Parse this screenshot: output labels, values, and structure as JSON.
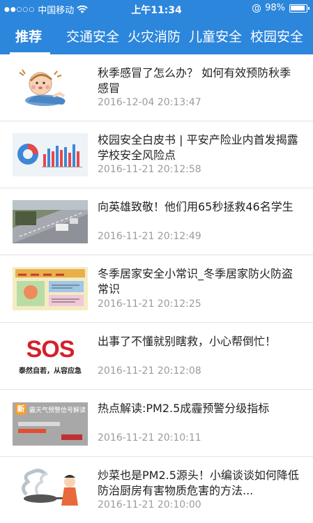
{
  "status_bar": {
    "carrier": "中国移动",
    "signal": "●●○○○",
    "time": "上午11:34",
    "battery": "98%"
  },
  "tabs": [
    {
      "label": "推荐",
      "active": true
    },
    {
      "label": "交通安全"
    },
    {
      "label": "火灾消防"
    },
    {
      "label": "儿童安全"
    },
    {
      "label": "校园安全"
    }
  ],
  "news": [
    {
      "title": "秋季感冒了怎么办？  如何有效预防秋季感冒",
      "date": "2016-12-04 20:13:47",
      "thumb": "cold-child-illustration"
    },
    {
      "title": "校园安全白皮书 | 平安产险业内首发揭露学校安全风险点",
      "date": "2016-11-21 20:12:58",
      "thumb": "bar-chart-infographic"
    },
    {
      "title": "向英雄致敬！他们用65秒拯救46名学生",
      "date": "2016-11-21 20:12:49",
      "thumb": "highway-photo"
    },
    {
      "title": "冬季居家安全小常识_冬季居家防火防盗常识",
      "date": "2016-11-21 20:12:25",
      "thumb": "children-drawing"
    },
    {
      "title": "出事了不懂就别瞎救，小心帮倒忙！",
      "date": "2016-11-21 20:12:08",
      "thumb": "sos-logo",
      "thumb_text": {
        "sos": "SOS",
        "caption": "泰然自若，从容应急"
      }
    },
    {
      "title": "热点解读:PM2.5成霾预警分级指标",
      "date": "2016-11-21 20:10:11",
      "thumb": "haze-warning",
      "thumb_text": {
        "badge": "新",
        "headline": "霾天气预警信号解读"
      }
    },
    {
      "title": "炒菜也是PM2.5源头！小编谈谈如何降低防治厨房有害物质危害的方法...",
      "date": "2016-11-21 20:10:00",
      "thumb": "cooking-smoke-illustration"
    }
  ],
  "colors": {
    "primary": "#2c86dc",
    "title": "#222222",
    "date": "#9b9b9b",
    "sos_red": "#d4202c"
  }
}
